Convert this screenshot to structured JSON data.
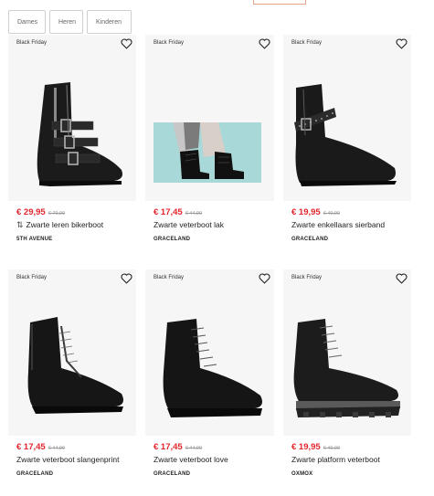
{
  "filters": [
    "Dames",
    "Heren",
    "Kinderen"
  ],
  "products": [
    {
      "badge": "Black Friday",
      "price": "€ 29,95",
      "old_price": "€ 79,99",
      "title": "Zwarte leren bikerboot",
      "brand": "5TH AVENUE",
      "has_icon": true
    },
    {
      "badge": "Black Friday",
      "price": "€ 17,45",
      "old_price": "€ 44,99",
      "title": "Zwarte veterboot lak",
      "brand": "GRACELAND"
    },
    {
      "badge": "Black Friday",
      "price": "€ 19,95",
      "old_price": "€ 49,99",
      "title": "Zwarte enkellaars sierband",
      "brand": "GRACELAND"
    },
    {
      "badge": "Black Friday",
      "price": "€ 17,45",
      "old_price": "€ 44,99",
      "title": "Zwarte veterboot slangenprint",
      "brand": "GRACELAND"
    },
    {
      "badge": "Black Friday",
      "price": "€ 17,45",
      "old_price": "€ 44,99",
      "title": "Zwarte veterboot love",
      "brand": "GRACELAND"
    },
    {
      "badge": "Black Friday",
      "price": "€ 19,95",
      "old_price": "€ 49,99",
      "title": "Zwarte platform veterboot",
      "brand": "OXMOX"
    }
  ],
  "icons": {
    "favorite": "heart-outline-icon",
    "compare": "swap-icon"
  },
  "colors": {
    "price": "#e3262d",
    "card_bg": "#f6f6f6"
  }
}
